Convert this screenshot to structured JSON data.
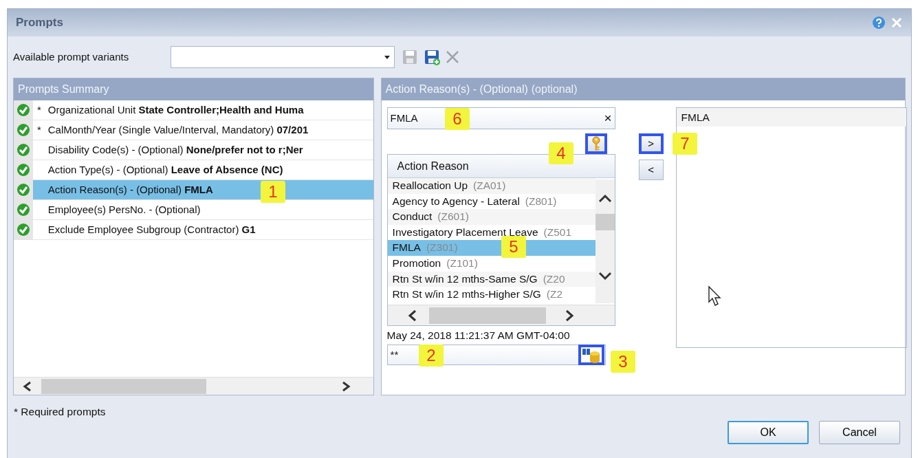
{
  "window": {
    "title": "Prompts"
  },
  "variants": {
    "label": "Available prompt variants",
    "tools": [
      {
        "kind": "save",
        "disabled": true
      },
      {
        "kind": "save_as",
        "disabled": false
      },
      {
        "kind": "delete",
        "disabled": true
      }
    ]
  },
  "summary": {
    "title": "Prompts Summary",
    "rows": [
      {
        "marker": "*",
        "text": "Organizational Unit **State Controller;Health and Huma**",
        "valid": true,
        "selected": false
      },
      {
        "marker": "*",
        "text": "CalMonth/Year (Single Value/Interval, Mandatory) **07/201**",
        "valid": true,
        "selected": false
      },
      {
        "text": "Disability Code(s) - (Optional) **None/prefer not to r;Ner**",
        "valid": true,
        "selected": false
      },
      {
        "text": "Action Type(s) - (Optional) **Leave of Absence (NC)**",
        "valid": true,
        "selected": false
      },
      {
        "text": "Action Reason(s) - (Optional) **FMLA**",
        "valid": true,
        "selected": true
      },
      {
        "text": "Employee(s) PersNo. - (Optional)",
        "valid": true,
        "selected": false
      },
      {
        "text": "Exclude Employee Subgroup (Contractor) **G1**",
        "valid": true,
        "selected": false
      }
    ]
  },
  "detail": {
    "title": "Action Reason(s) - (Optional)",
    "hint": "(optional)",
    "search": {
      "value": "FMLA",
      "clear": "×"
    },
    "key_button": {
      "highlighted": true
    },
    "list": {
      "header": "Action Reason",
      "items": [
        {
          "label": "Reallocation Up",
          "code": "(ZA01)",
          "selected": false
        },
        {
          "label": "Agency to Agency - Lateral",
          "code": "(Z801)",
          "selected": false
        },
        {
          "label": "Conduct",
          "code": "(Z601)",
          "selected": false
        },
        {
          "label": "Investigatory Placement Leave",
          "code": "(Z501",
          "selected": false
        },
        {
          "label": "FMLA",
          "code": "(Z301)",
          "selected": true
        },
        {
          "label": "Promotion",
          "code": "(Z101)",
          "selected": false
        },
        {
          "label": "Rtn St w/in 12 mths-Same S/G",
          "code": "(Z20",
          "selected": false
        },
        {
          "label": "Rtn St w/in 12 mths-Higher S/G",
          "code": "(Z2",
          "selected": false
        }
      ]
    },
    "timestamp": "May 24, 2018 11:21:37 AM GMT-04:00",
    "filter": {
      "value": "**",
      "button_highlighted": true
    },
    "move_buttons": [
      {
        "label": ">",
        "highlighted": true
      },
      {
        "label": "<",
        "highlighted": false
      }
    ],
    "selected_values": [
      "FMLA"
    ]
  },
  "callouts": [
    "1",
    "2",
    "3",
    "4",
    "5",
    "6",
    "7"
  ],
  "footer": {
    "note": "* Required prompts",
    "buttons": [
      {
        "label": "OK",
        "default": true
      },
      {
        "label": "Cancel",
        "default": false
      }
    ]
  }
}
